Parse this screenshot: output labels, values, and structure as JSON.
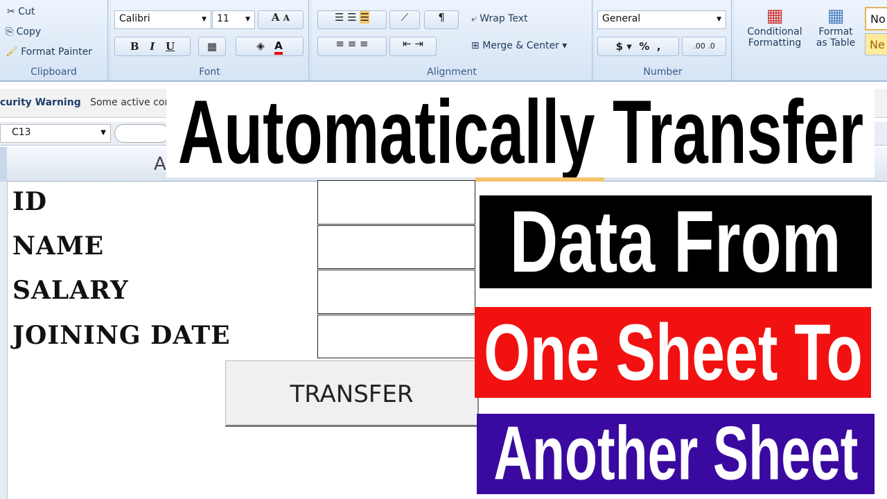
{
  "ribbon": {
    "clipboard": {
      "cut": "Cut",
      "copy": "Copy",
      "format_painter": "Format Painter",
      "label": "Clipboard"
    },
    "font": {
      "name": "Calibri",
      "size": "11",
      "bold": "B",
      "italic": "I",
      "underline": "U",
      "grow": "A",
      "shrink": "A",
      "label": "Font"
    },
    "alignment": {
      "wrap_text": "Wrap Text",
      "merge_center": "Merge & Center",
      "label": "Alignment"
    },
    "number": {
      "format": "General",
      "currency": "$",
      "percent": "%",
      "comma": ",",
      "inc_decimal": ".00",
      "dec_decimal": ".0",
      "label": "Number"
    },
    "styles": {
      "conditional": "Conditional",
      "conditional2": "Formatting",
      "format_table": "Format",
      "format_table2": "as Table",
      "normal": "No",
      "neutral": "Ne"
    }
  },
  "security": {
    "title": "curity Warning",
    "message": "Some active cor"
  },
  "name_box": "C13",
  "column_header": "A",
  "form": {
    "labels": [
      "ID",
      "NAME",
      "SALARY",
      "JOINING DATE"
    ],
    "button": "TRANSFER"
  },
  "banners": {
    "line1": "Automatically Transfer",
    "line2": "Data From",
    "line3": "One Sheet To",
    "line4": "Another Sheet"
  },
  "colors": {
    "line2_bg": "#000000",
    "line3_bg": "#f21111",
    "line4_bg": "#3a0aa0"
  }
}
